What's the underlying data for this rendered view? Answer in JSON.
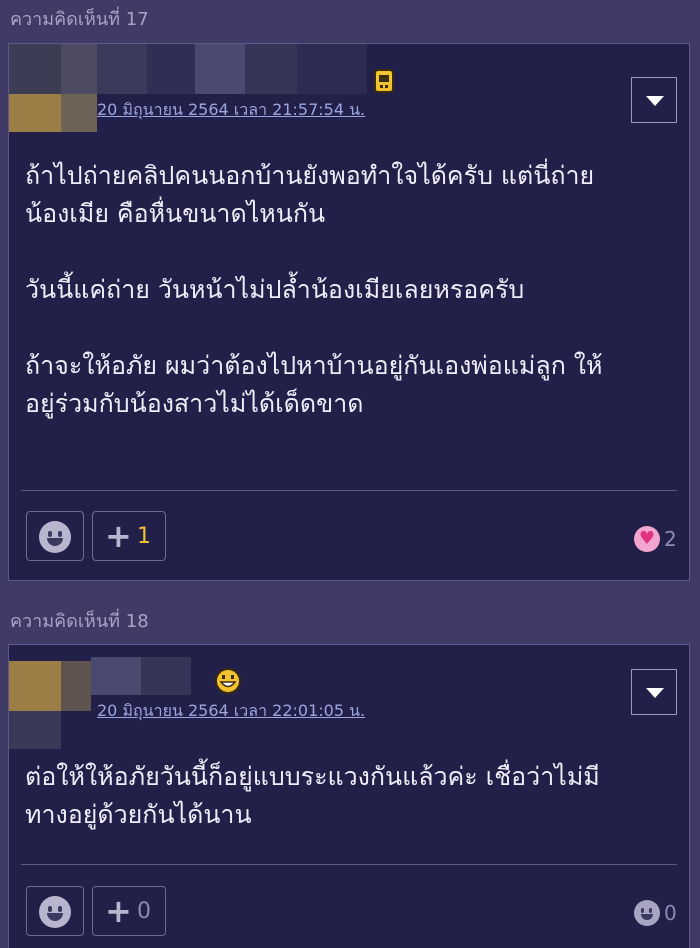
{
  "comments": [
    {
      "label": "ความคิดเห็นที่ 17",
      "timestamp": "20 มิถุนายน 2564 เวลา 21:57:54 น.",
      "body": "ถ้าไปถ่ายคลิปคนนอกบ้านยังพอทำใจได้ครับ แต่นี่ถ่าย\nน้องเมีย คือหื่นขนาดไหนกัน\n\nวันนี้แค่ถ่าย วันหน้าไม่ปล้ำน้องเมียเลยหรอครับ\n\nถ้าจะให้อภัย ผมว่าต้องไปหาบ้านอยู่กันเองพ่อแม่ลูก ให้\nอยู่ร่วมกับน้องสาวไม่ได้เด็ดขาด",
      "plus_count": "1",
      "reaction_count": "2",
      "badge_icon": "yellow-device-badge-icon",
      "reaction_icon": "heart-icon"
    },
    {
      "label": "ความคิดเห็นที่ 18",
      "timestamp": "20 มิถุนายน 2564 เวลา 22:01:05 น.",
      "body": "ต่อให้ให้อภัยวันนี้ก็อยู่แบบระแวงกันแล้วค่ะ เชื่อว่าไม่มี\nทางอยู่ด้วยกันได้นาน",
      "plus_count": "0",
      "reaction_count": "0",
      "badge_icon": "grin-emoji-icon",
      "reaction_icon": "smiley-icon"
    }
  ],
  "colors": {
    "background": "#3f3a66",
    "card": "#222049",
    "plus_active": "#f2c230",
    "plus_inactive": "#8e8ab4",
    "link": "#9ea6e0"
  }
}
